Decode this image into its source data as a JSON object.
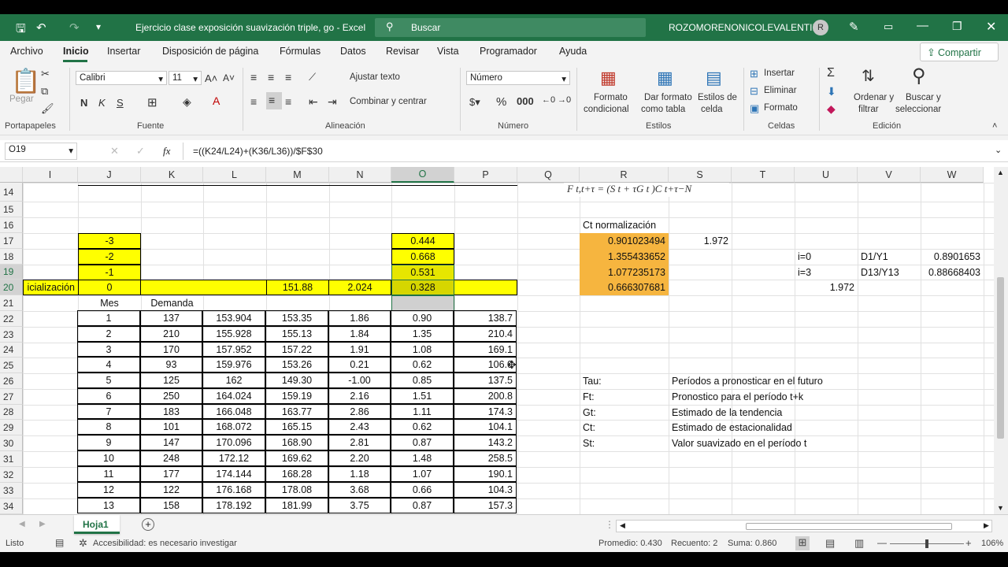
{
  "titlebar": {
    "file_title": "Ejercicio clase exposición suavización triple, go  -  Excel",
    "search_placeholder": "Buscar",
    "user": "ROZOMORENONICOLEVALENTINA",
    "avatar_initial": "R"
  },
  "menu": [
    "Archivo",
    "Inicio",
    "Insertar",
    "Disposición de página",
    "Fórmulas",
    "Datos",
    "Revisar",
    "Vista",
    "Programador",
    "Ayuda"
  ],
  "share_label": "Compartir",
  "ribbon": {
    "paste": "Pegar",
    "clipboard": "Portapapeles",
    "font_name": "Calibri",
    "font_size": "11",
    "bold": "N",
    "italic": "K",
    "underline": "S",
    "font": "Fuente",
    "wrap_text": "Ajustar texto",
    "merge_center": "Combinar y centrar",
    "alignment": "Alineación",
    "number_format": "Número",
    "number_group": "Número",
    "cond_format_1": "Formato",
    "cond_format_2": "condicional",
    "format_table_1": "Dar formato",
    "format_table_2": "como tabla",
    "cell_styles_1": "Estilos de",
    "cell_styles_2": "celda",
    "styles": "Estilos",
    "insert": "Insertar",
    "delete": "Eliminar",
    "format": "Formato",
    "cells": "Celdas",
    "sort_1": "Ordenar y",
    "sort_2": "filtrar",
    "find_1": "Buscar y",
    "find_2": "seleccionar",
    "editing": "Edición"
  },
  "formula_bar": {
    "name_box": "O19",
    "fx": "fx",
    "formula": "=((K24/L24)+(K36/L36))/$F$30"
  },
  "columns": [
    "I",
    "J",
    "K",
    "L",
    "M",
    "N",
    "O",
    "P",
    "Q",
    "R",
    "S",
    "T",
    "U",
    "V",
    "W"
  ],
  "rows": [
    "14",
    "15",
    "16",
    "17",
    "18",
    "19",
    "20",
    "21",
    "22",
    "23",
    "24",
    "25",
    "26",
    "27",
    "28",
    "29",
    "30",
    "31",
    "32",
    "33",
    "34"
  ],
  "cells": {
    "formula_fragment": "F t,t+τ = (S t + τG t )C t+τ−N",
    "j17": "-3",
    "j18": "-2",
    "j19": "-1",
    "j20": "0",
    "i20": "icialización",
    "m20": "151.88",
    "n20": "2.024",
    "o17": "0.444",
    "o18": "0.668",
    "o19": "0.531",
    "o20": "0.328",
    "j21": "Mes",
    "k21": "Demanda",
    "r16": "Ct normalización",
    "r17": "0.901023494",
    "r18": "1.355433652",
    "r19": "1.077235173",
    "r20": "0.666307681",
    "s17": "1.972",
    "u18": "i=0",
    "v18": "D1/Y1",
    "w18": "0.8901653",
    "u19": "i=3",
    "v19": "D13/Y13",
    "w19": "0.88668403",
    "u20": "1.972",
    "r26": "Tau:",
    "s26": "Períodos a pronosticar en el futuro",
    "r27": "Ft:",
    "s27": "Pronostico para el período t+k",
    "r28": "Gt:",
    "s28": "Estimado de la tendencia",
    "r29": "Ct:",
    "s29": "Estimado de estacionalidad",
    "r30": "St:",
    "s30": "Valor suavizado en el período t"
  },
  "table": [
    [
      "1",
      "137",
      "153.904",
      "153.35",
      "1.86",
      "0.90",
      "138.7"
    ],
    [
      "2",
      "210",
      "155.928",
      "155.13",
      "1.84",
      "1.35",
      "210.4"
    ],
    [
      "3",
      "170",
      "157.952",
      "157.22",
      "1.91",
      "1.08",
      "169.1"
    ],
    [
      "4",
      "93",
      "159.976",
      "153.26",
      "0.21",
      "0.62",
      "106.0"
    ],
    [
      "5",
      "125",
      "162",
      "149.30",
      "-1.00",
      "0.85",
      "137.5"
    ],
    [
      "6",
      "250",
      "164.024",
      "159.19",
      "2.16",
      "1.51",
      "200.8"
    ],
    [
      "7",
      "183",
      "166.048",
      "163.77",
      "2.86",
      "1.11",
      "174.3"
    ],
    [
      "8",
      "101",
      "168.072",
      "165.15",
      "2.43",
      "0.62",
      "104.1"
    ],
    [
      "9",
      "147",
      "170.096",
      "168.90",
      "2.81",
      "0.87",
      "143.2"
    ],
    [
      "10",
      "248",
      "172.12",
      "169.62",
      "2.20",
      "1.48",
      "258.5"
    ],
    [
      "11",
      "177",
      "174.144",
      "168.28",
      "1.18",
      "1.07",
      "190.1"
    ],
    [
      "12",
      "122",
      "176.168",
      "178.08",
      "3.68",
      "0.66",
      "104.3"
    ],
    [
      "13",
      "158",
      "178.192",
      "181.99",
      "3.75",
      "0.87",
      "157.3"
    ]
  ],
  "sheet_tab": "Hoja1",
  "status": {
    "ready": "Listo",
    "accessibility": "Accesibilidad: es necesario investigar",
    "average": "Promedio: 0.430",
    "count": "Recuento: 2",
    "sum": "Suma: 0.860",
    "zoom": "106%"
  }
}
